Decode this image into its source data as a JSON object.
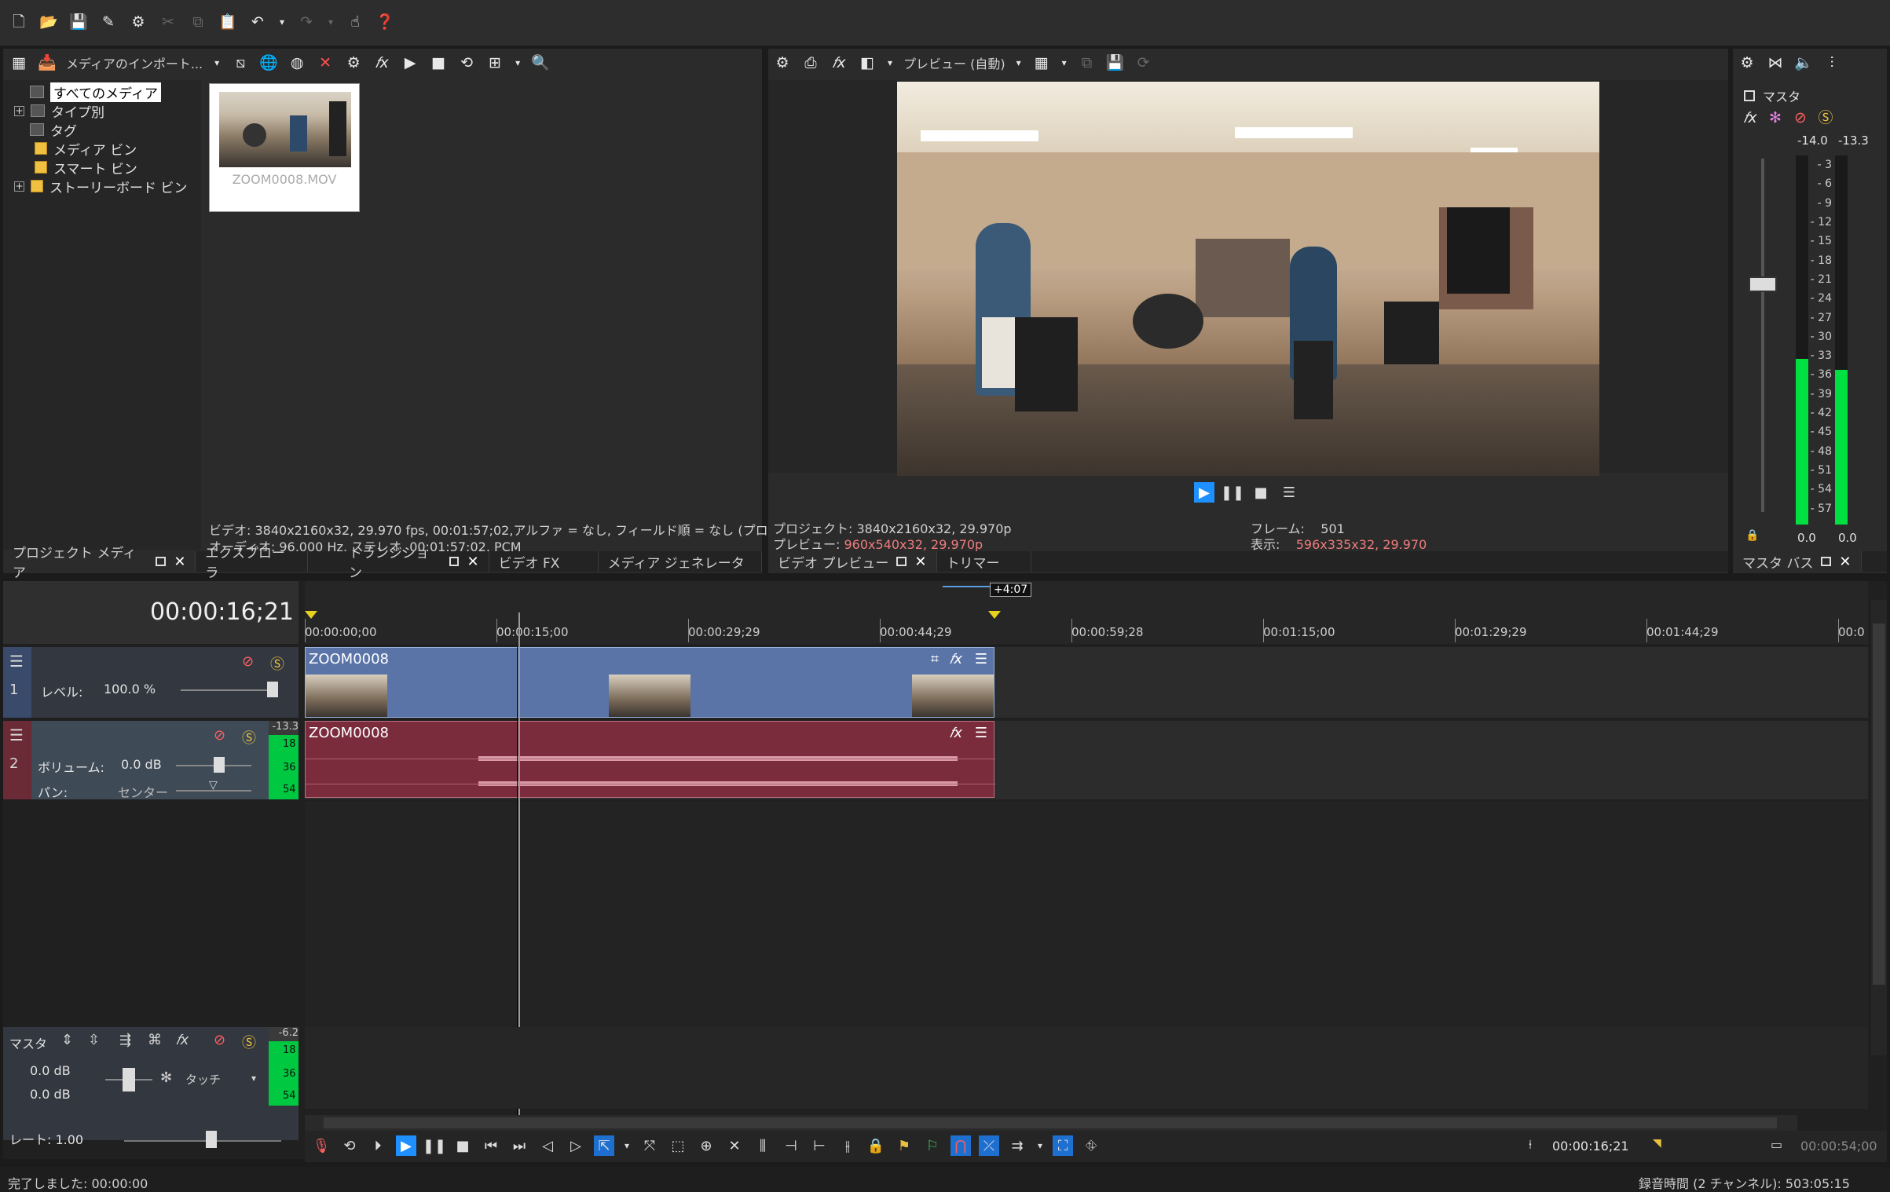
{
  "toolbar": {
    "icons": [
      "new-project-icon",
      "open-icon",
      "save-icon",
      "render-icon",
      "properties-icon",
      "cut-icon",
      "copy-icon",
      "paste-icon",
      "undo-icon",
      "redo-icon",
      "help-icon",
      "whats-this-icon"
    ]
  },
  "media_panel": {
    "import_label": "メディアのインポート...",
    "tree": [
      {
        "label": "すべてのメディア",
        "selected": true,
        "expand": false,
        "type": "media"
      },
      {
        "label": "タイプ別",
        "expand": true,
        "type": "media"
      },
      {
        "label": "タグ",
        "expand": false,
        "type": "media"
      },
      {
        "label": "メディア ビン",
        "expand": false,
        "type": "folder"
      },
      {
        "label": "スマート ビン",
        "expand": false,
        "type": "folder"
      },
      {
        "label": "ストーリーボード ビン",
        "expand": true,
        "type": "folder"
      }
    ],
    "thumbnail_caption": "ZOOM0008.MOV",
    "info_video": "ビデオ: 3840x2160x32, 29.970 fps, 00:01:57;02,アルファ = なし, フィールド順 = なし (プログ",
    "info_audio": "オーディオ: 96,000 Hz, ステレオ, 00:01:57;02, PCM",
    "tabs": [
      "プロジェクト メディア",
      "エクスプローラ",
      "トランジション",
      "ビデオ FX",
      "メディア ジェネレータ"
    ]
  },
  "preview_panel": {
    "mode_label": "プレビュー (自動)",
    "project_label": "プロジェクト:",
    "project_value": "3840x2160x32, 29.970p",
    "preview_label": "プレビュー:",
    "preview_value": "960x540x32, 29.970p",
    "frame_label": "フレーム:",
    "frame_value": "501",
    "display_label": "表示:",
    "display_value": "596x335x32, 29.970",
    "tabs": [
      "ビデオ プレビュー",
      "トリマー"
    ]
  },
  "master_bus": {
    "title": "マスタ",
    "peak_left": "-14.0",
    "peak_right": "-13.3",
    "scale": [
      "3",
      "6",
      "9",
      "12",
      "15",
      "18",
      "21",
      "24",
      "27",
      "30",
      "33",
      "36",
      "39",
      "42",
      "45",
      "48",
      "51",
      "54",
      "57"
    ],
    "bottom_left": "0.0",
    "bottom_right": "0.0",
    "tab": "マスタ バス",
    "level_left": 0.45,
    "level_right": 0.42
  },
  "timeline": {
    "timecode": "00:00:16;21",
    "marker_label": "+4:07",
    "ruler": [
      "00:00:00;00",
      "00:00:15;00",
      "00:00:29;29",
      "00:00:44;29",
      "00:00:59;28",
      "00:01:15;00",
      "00:01:29;29",
      "00:01:44;29",
      "00:0"
    ],
    "video_track": {
      "number": "1",
      "level_label": "レベル:",
      "level_value": "100.0 %",
      "clip": "ZOOM0008"
    },
    "audio_track": {
      "number": "2",
      "volume_label": "ボリューム:",
      "volume_value": "0.0 dB",
      "pan_label": "パン:",
      "pan_value": "センター",
      "peak": "-13.3",
      "clip": "ZOOM0008",
      "meter": [
        "18",
        "36",
        "54"
      ]
    },
    "master": {
      "label": "マスタ",
      "db1": "0.0 dB",
      "db2": "0.0 dB",
      "touch": "タッチ",
      "peak": "-6.2",
      "meter": [
        "18",
        "36",
        "54"
      ]
    }
  },
  "transport": {
    "rate_label": "レート: 1.00",
    "cursor_time": "00:00:16;21",
    "end_time": "00:00:54;00"
  },
  "status": {
    "left": "完了しました: 00:00:00",
    "right": "録音時間 (2 チャンネル): 503:05:15"
  }
}
